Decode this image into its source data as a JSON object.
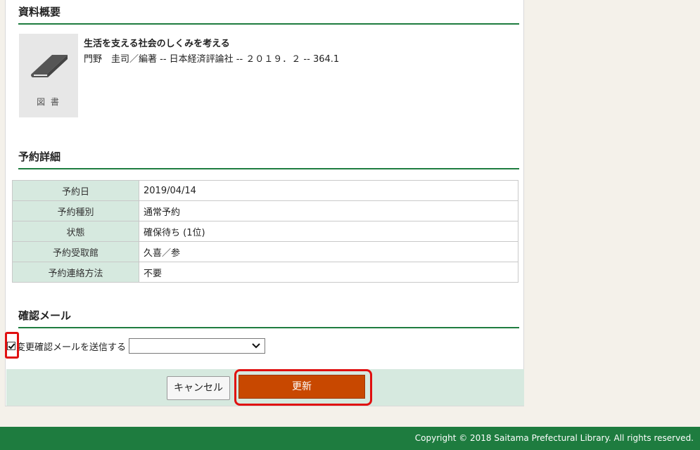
{
  "overview": {
    "heading": "資料概要",
    "thumbnail_caption": "図 書",
    "thumbnail_icon": "book-icon",
    "title": "生活を支える社会のしくみを考える",
    "meta": "門野　圭司／編著 -- 日本経済評論社 -- ２０１９．２ -- 364.1"
  },
  "detail": {
    "heading": "予約詳細",
    "rows": [
      {
        "label": "予約日",
        "value": "2019/04/14"
      },
      {
        "label": "予約種別",
        "value": "通常予約"
      },
      {
        "label": "状態",
        "value": "確保待ち (1位)"
      },
      {
        "label": "予約受取館",
        "value": "久喜／参"
      },
      {
        "label": "予約連絡方法",
        "value": "不要"
      }
    ]
  },
  "mail": {
    "heading": "確認メール",
    "checkbox_label": "変更確認メールを送信する",
    "checkbox_checked": true,
    "select_value": ""
  },
  "buttons": {
    "cancel_label": "キャンセル",
    "update_label": "更新",
    "update_color": "#c84800"
  },
  "footer": {
    "copyright": "Copyright © 2018 Saitama Prefectural Library. All rights reserved."
  },
  "colors": {
    "accent_green": "#1e7c3f",
    "highlight_red": "#e01010",
    "label_bg": "#d6e9df"
  }
}
